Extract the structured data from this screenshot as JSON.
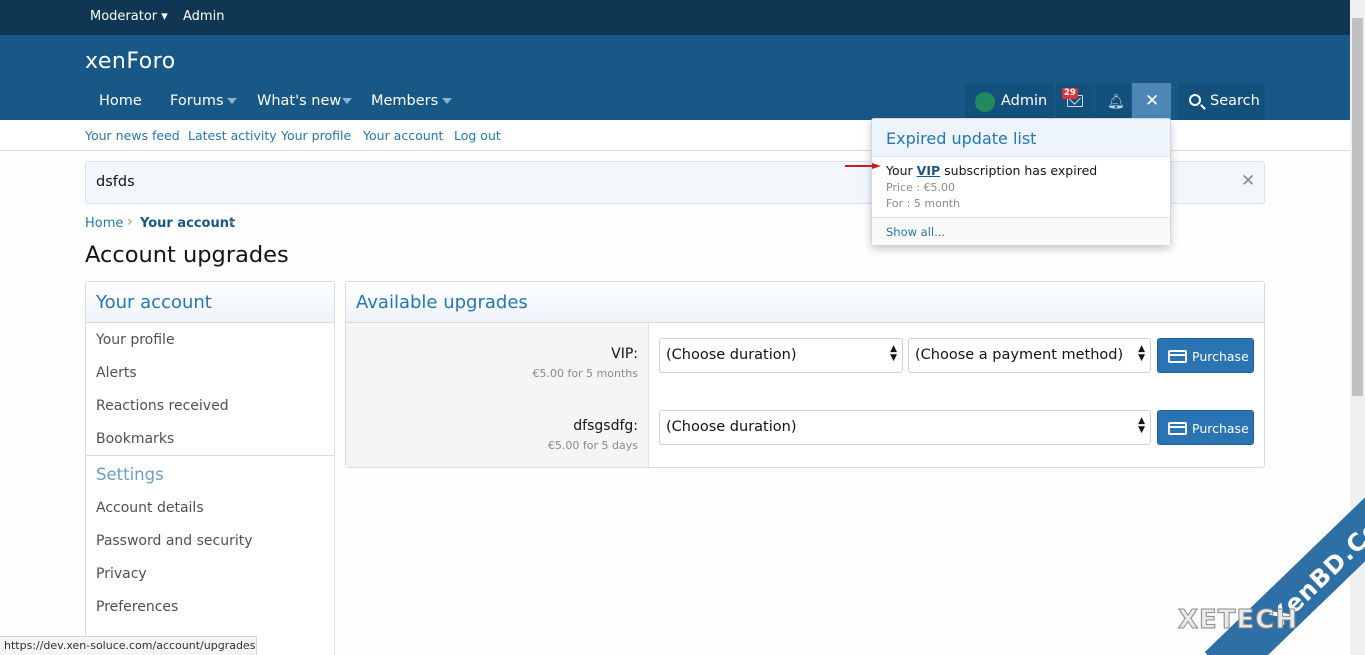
{
  "staffbar": {
    "moderator": "Moderator",
    "admin": "Admin"
  },
  "header": {
    "logo": "xenForo"
  },
  "nav": {
    "tabs": [
      {
        "label": "Home"
      },
      {
        "label": "Forums"
      },
      {
        "label": "What's new"
      },
      {
        "label": "Members"
      }
    ],
    "user": "Admin",
    "mail_badge": "29",
    "search_label": "Search"
  },
  "subnav": [
    "Your news feed",
    "Latest activity",
    "Your profile",
    "Your account",
    "Log out"
  ],
  "notice": {
    "text": "dsfds"
  },
  "breadcrumb": {
    "home": "Home",
    "current": "Your account"
  },
  "page_title": "Account upgrades",
  "sidebar": {
    "title": "Your account",
    "items": [
      "Your profile",
      "Alerts",
      "Reactions received",
      "Bookmarks"
    ],
    "settings_title": "Settings",
    "settings_items": [
      "Account details",
      "Password and security",
      "Privacy",
      "Preferences"
    ]
  },
  "main": {
    "title": "Available upgrades",
    "rows": [
      {
        "label": "VIP:",
        "hint": "€5.00 for 5 months",
        "duration": "(Choose duration)",
        "payment": "(Choose a payment method)",
        "button": "Purchase"
      },
      {
        "label": "dfsgsdfg:",
        "hint": "€5.00 for 5 days",
        "duration": "(Choose duration)",
        "button": "Purchase"
      }
    ]
  },
  "popup": {
    "title": "Expired update list",
    "msg_prefix": "Your ",
    "msg_link": "VIP",
    "msg_suffix": " subscription has expired",
    "price": "Price : €5.00",
    "period": "For : 5 month",
    "footer": "Show all..."
  },
  "statusbar": {
    "url": "https://dev.xen-soluce.com/account/upgrades"
  },
  "watermark": {
    "text1": "XenBD.Com",
    "text2": "XETECH"
  },
  "colors": {
    "header": "#185886",
    "staffbar": "#0f3652",
    "accent": "#2577b1",
    "button": "#2b74b3",
    "arrow": "#c41f1f"
  }
}
